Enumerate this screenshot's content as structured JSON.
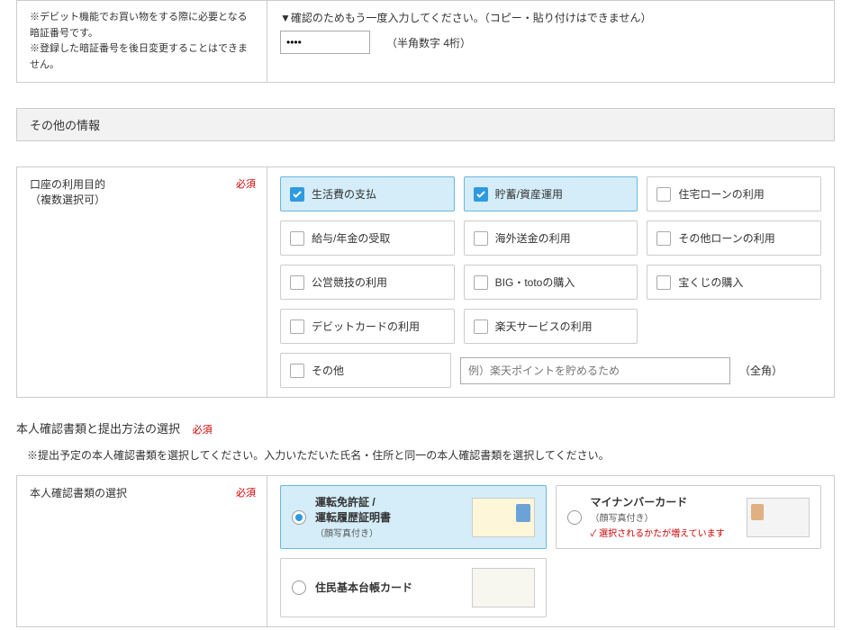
{
  "pin": {
    "note1": "※デビット機能でお買い物をする際に必要となる暗証番号です。",
    "note2": "※登録した暗証番号を後日変更することはできません。",
    "confirm_label": "▼確認のためもう一度入力してください。（コピー・貼り付けはできません）",
    "value": "••••",
    "hint": "（半角数字 4桁）"
  },
  "other_section_title": "その他の情報",
  "purpose": {
    "label": "口座の利用目的",
    "sublabel": "（複数選択可）",
    "required": "必須",
    "options": [
      {
        "label": "生活費の支払",
        "checked": true
      },
      {
        "label": "貯蓄/資産運用",
        "checked": true
      },
      {
        "label": "住宅ローンの利用",
        "checked": false
      },
      {
        "label": "給与/年金の受取",
        "checked": false
      },
      {
        "label": "海外送金の利用",
        "checked": false
      },
      {
        "label": "その他ローンの利用",
        "checked": false
      },
      {
        "label": "公営競技の利用",
        "checked": false
      },
      {
        "label": "BIG・totoの購入",
        "checked": false
      },
      {
        "label": "宝くじの購入",
        "checked": false
      },
      {
        "label": "デビットカードの利用",
        "checked": false
      },
      {
        "label": "楽天サービスの利用",
        "checked": false
      }
    ],
    "other_label": "その他",
    "other_placeholder": "例）楽天ポイントを貯めるため",
    "other_hint": "（全角）"
  },
  "id_doc": {
    "section_title": "本人確認書類と提出方法の選択",
    "required": "必須",
    "instruction": "※提出予定の本人確認書類を選択してください。入力いただいた氏名・住所と同一の本人確認書類を選択してください。",
    "row_label": "本人確認書類の選択",
    "row_required": "必須",
    "options": [
      {
        "main1": "運転免許証 /",
        "main2": "運転履歴証明書",
        "sub": "（顔写真付き）",
        "selected": true,
        "thumb": "license"
      },
      {
        "main1": "マイナンバーカード",
        "main2": "",
        "sub": "（顔写真付き）",
        "alert": "✓ 選択されるかたが増えています",
        "selected": false,
        "thumb": "myno"
      },
      {
        "main1": "住民基本台帳カード",
        "main2": "",
        "sub": "",
        "selected": false,
        "thumb": "juki"
      }
    ]
  }
}
